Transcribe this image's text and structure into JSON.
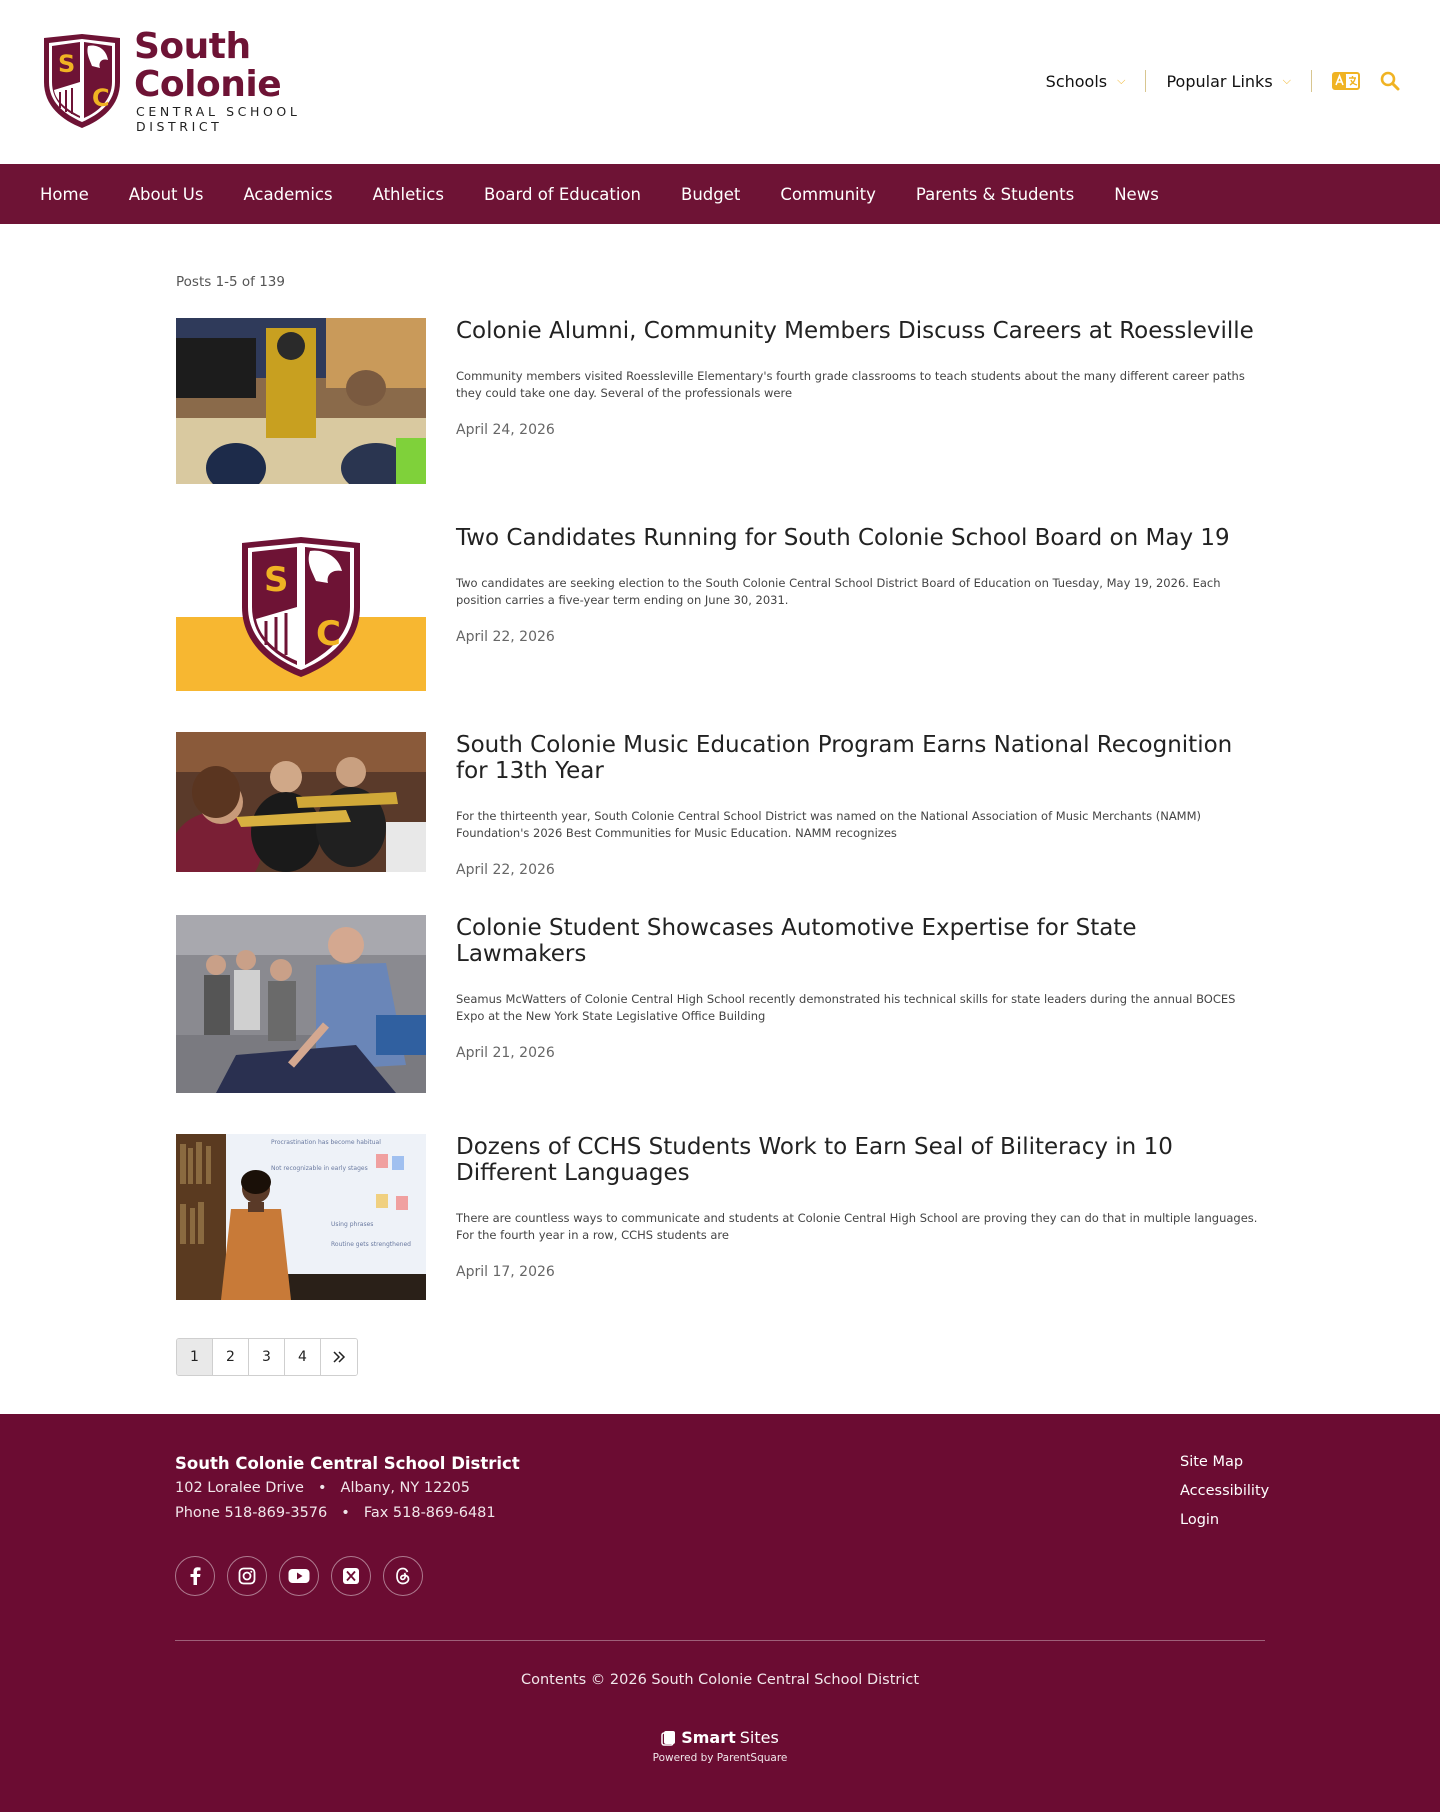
{
  "colors": {
    "brand": "#6e1335",
    "accent": "#f0b323",
    "footer_bg": "#6b0c32"
  },
  "logo": {
    "title": "South Colonie",
    "subtitle": "CENTRAL SCHOOL DISTRICT",
    "crest_letters": [
      "S",
      "C"
    ]
  },
  "utility": {
    "schools_label": "Schools",
    "popular_label": "Popular Links",
    "translate_icon": "translate-icon",
    "search_icon": "search-icon"
  },
  "nav": {
    "items": [
      "Home",
      "About Us",
      "Academics",
      "Athletics",
      "Board of Education",
      "Budget",
      "Community",
      "Parents & Students",
      "News"
    ]
  },
  "posts_count": "Posts 1-5 of 139",
  "posts": [
    {
      "title": "Colonie Alumni, Community Members Discuss Careers at Roessleville",
      "excerpt": "Community members visited Roessleville Elementary's fourth grade classrooms to teach students about the many different career paths they could take one day.  Several of the professionals were",
      "date": "April 24, 2026"
    },
    {
      "title": "Two Candidates Running for South Colonie School Board on May 19",
      "excerpt": "Two candidates are seeking election to the South Colonie Central School District Board of Education on Tuesday, May 19, 2026.  Each position carries a five-year term ending on June 30, 2031.",
      "date": "April 22, 2026"
    },
    {
      "title": "South Colonie Music Education Program Earns National Recognition for 13th Year",
      "excerpt": "For the thirteenth year, South Colonie Central School District was named on the National Association of Music Merchants (NAMM) Foundation's 2026 Best Communities for Music Education. NAMM recognizes",
      "date": "April 22, 2026"
    },
    {
      "title": "Colonie Student Showcases Automotive Expertise for State Lawmakers",
      "excerpt": "Seamus McWatters of Colonie Central High School recently demonstrated his technical skills for state leaders during the annual BOCES Expo at the New York State Legislative Office Building",
      "date": "April 21, 2026"
    },
    {
      "title": "Dozens of CCHS Students Work to Earn Seal of Biliteracy in 10 Different Languages",
      "excerpt": "There are countless ways to communicate and students at Colonie Central High School are proving they can do that in multiple languages.  For the fourth year in a row, CCHS students are",
      "date": "April 17, 2026"
    }
  ],
  "slide_text": [
    "Procrastination has become habitual",
    "Not recognizable in early stages",
    "Using phrases",
    "Routine gets strengthened"
  ],
  "pagination": {
    "pages": [
      "1",
      "2",
      "3",
      "4"
    ],
    "current": "1",
    "next_icon": "double-chevron-right-icon"
  },
  "footer": {
    "name": "South Colonie Central School District",
    "address1": "102 Loralee Drive",
    "address2": "Albany, NY 12205",
    "phone": "Phone 518-869-3576",
    "fax": "Fax 518-869-6481",
    "dot": "•",
    "social_icons": [
      "facebook-icon",
      "instagram-icon",
      "youtube-icon",
      "x-icon",
      "threads-icon"
    ],
    "links": [
      "Site Map",
      "Accessibility",
      "Login"
    ],
    "copyright": "Contents © 2026 South Colonie Central School District",
    "smart": "Smart",
    "sites": "Sites",
    "powered": "Powered by ParentSquare"
  }
}
